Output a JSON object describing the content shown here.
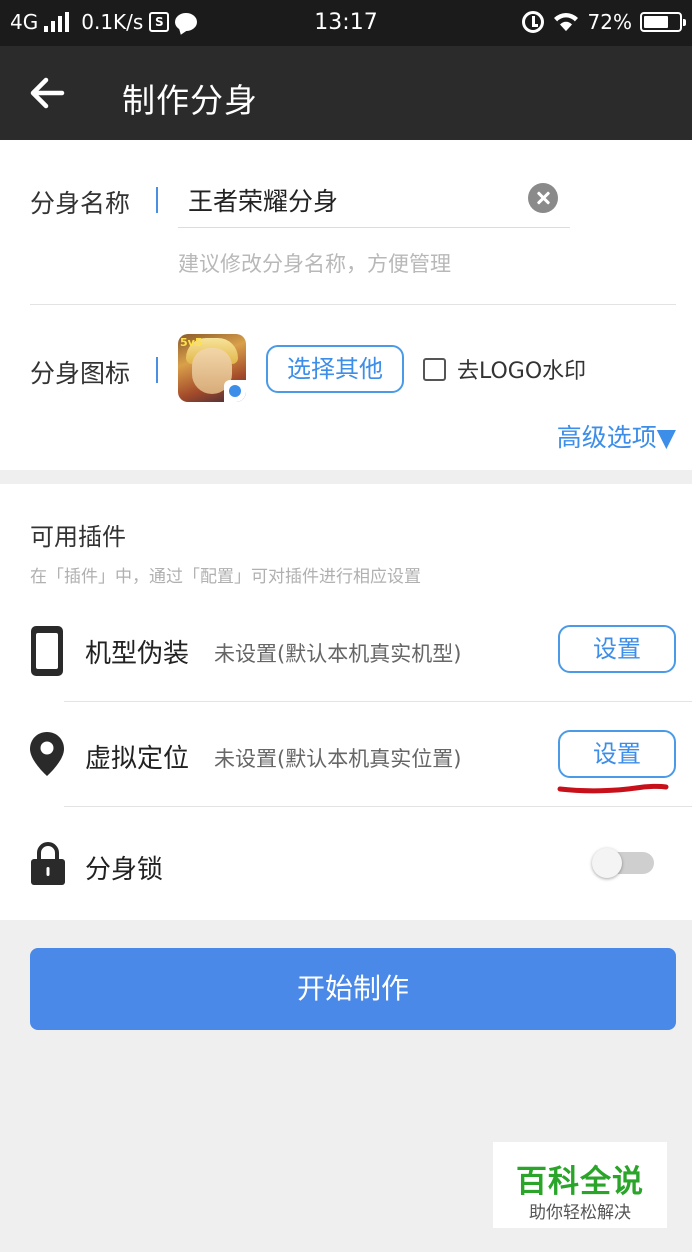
{
  "status_bar": {
    "network": "4G",
    "speed": "0.1K/s",
    "box_icon": "S",
    "time": "13:17",
    "battery_text": "72%",
    "battery_level": 0.72
  },
  "header": {
    "title": "制作分身",
    "back_icon": "arrow-left-icon"
  },
  "clone_name": {
    "label": "分身名称",
    "value": "王者荣耀分身",
    "hint": "建议修改分身名称，方便管理"
  },
  "clone_icon": {
    "label": "分身图标",
    "choose_label": "选择其他",
    "remove_logo_label": "去LOGO水印",
    "remove_logo_checked": false,
    "app_icon_text": "5v5",
    "advanced_label": "高级选项▼"
  },
  "plugins": {
    "title": "可用插件",
    "subtitle": "在「插件」中，通过「配置」可对插件进行相应设置",
    "items": [
      {
        "icon": "phone-icon",
        "name": "机型伪装",
        "status": "未设置(默认本机真实机型)",
        "button": "设置"
      },
      {
        "icon": "location-pin-icon",
        "name": "虚拟定位",
        "status": "未设置(默认本机真实位置)",
        "button": "设置"
      }
    ],
    "lock": {
      "icon": "lock-icon",
      "name": "分身锁",
      "enabled": false
    }
  },
  "start_button": "开始制作",
  "watermark": {
    "title": "百科全说",
    "subtitle": "助你轻松解决"
  },
  "colors": {
    "accent": "#4a89e8",
    "status_bar": "#1b1b1b",
    "nav_bar": "#2b2b2b",
    "annotation": "#c8101a",
    "watermark_green": "#2aa52a"
  }
}
